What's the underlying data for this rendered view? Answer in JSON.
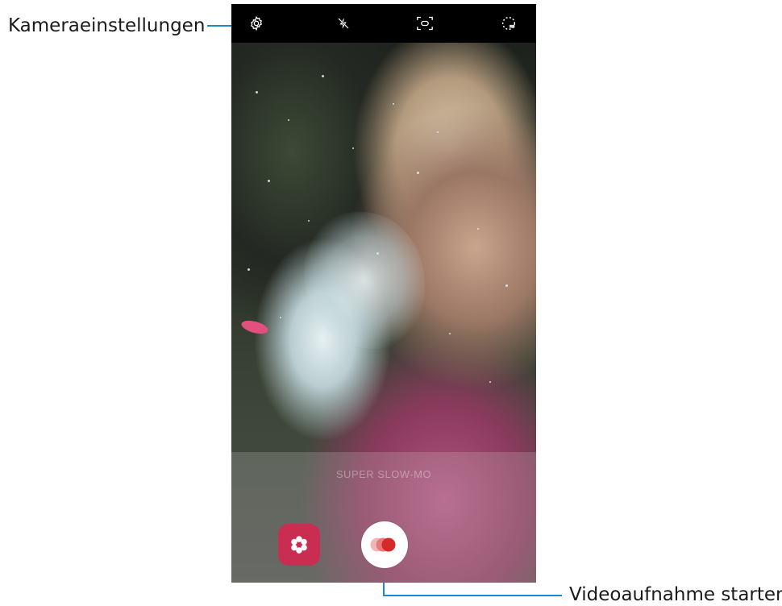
{
  "callouts": {
    "settings_label": "Kameraeinstellungen",
    "record_label": "Videoaufnahme starten."
  },
  "toolbar": {
    "icons": [
      "gear-icon",
      "flash-off-icon",
      "aspect-ratio-icon",
      "timer-icon"
    ]
  },
  "bottom": {
    "hint_text": "SUPER SLOW-MO"
  },
  "colors": {
    "callout_line": "#1f87c9",
    "effect_button": "#c92e52",
    "record_dot": "#d62a2a"
  }
}
